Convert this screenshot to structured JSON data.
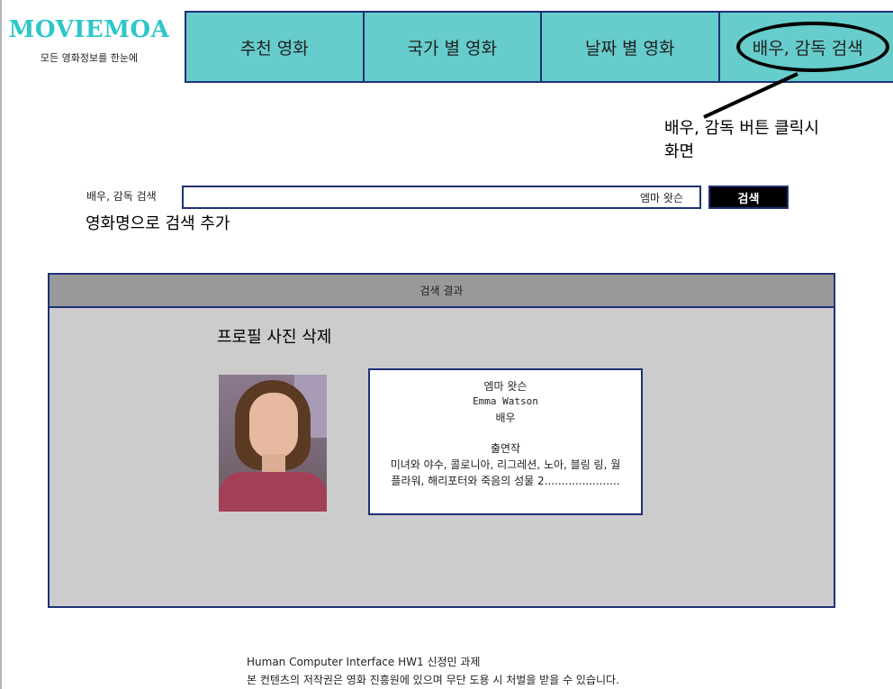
{
  "logo": {
    "title": "MOVIEMOA",
    "subtitle": "모든 영화정보를 한눈에"
  },
  "nav": {
    "items": [
      {
        "label": "추천 영화"
      },
      {
        "label": "국가 별 영화"
      },
      {
        "label": "날짜 별 영화"
      },
      {
        "label": "배우, 감독 검색"
      }
    ]
  },
  "annotations": {
    "nav_click_line1": "배우, 감독 버튼 클릭시",
    "nav_click_line2": "화면",
    "search_add": "영화명으로 검색 추가",
    "photo_delete": "프로필 사진 삭제"
  },
  "search": {
    "label": "배우, 감독 검색",
    "value": "엠마 왓슨",
    "button_label": "검색"
  },
  "result": {
    "header": "검색 결과",
    "card": {
      "name_ko": "엠마 왓슨",
      "name_en": "Emma Watson",
      "role": "배우",
      "works_title": "출연작",
      "works": "미녀와 야수, 콜로니아, 리그레션, 노아, 블링 링, 월플라워, 해리포터와 죽음의 성물 2......................"
    }
  },
  "footer": {
    "line1": "Human Computer Interface HW1 신정민 과제",
    "line2": "본 컨텐츠의 저작권은 영화 진흥원에 있으며 무단 도용 시 처벌을 받을 수 있습니다."
  },
  "colors": {
    "accent": "#66cccc",
    "logo": "#2ec7c9",
    "border": "#1f3175",
    "panel": "#cccccc",
    "panel_header": "#999999"
  }
}
